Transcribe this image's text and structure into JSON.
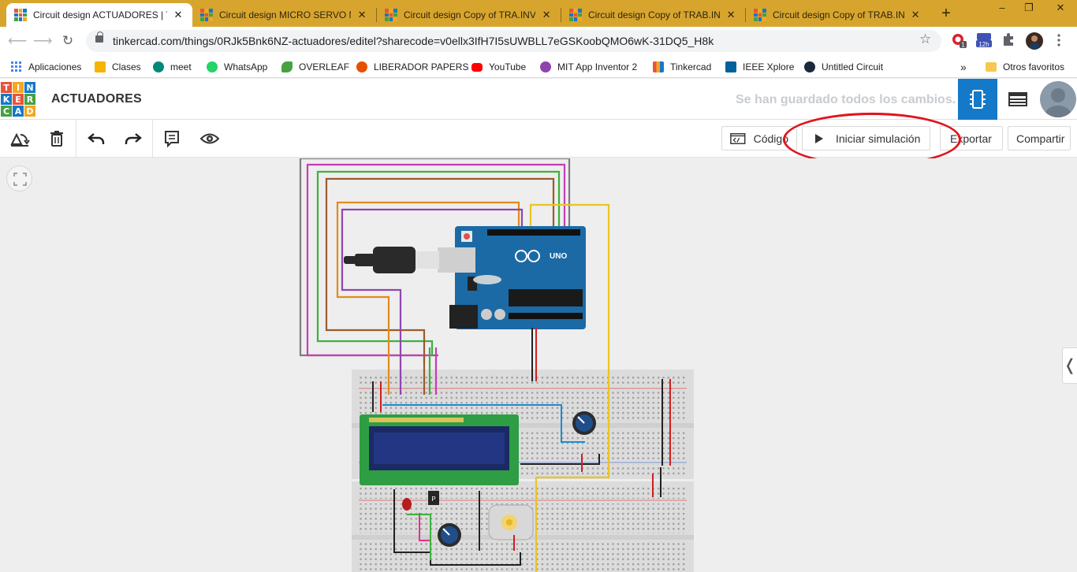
{
  "browser": {
    "tabs": [
      {
        "title": "Circuit design ACTUADORES | Ti",
        "active": true
      },
      {
        "title": "Circuit design MICRO SERVO M"
      },
      {
        "title": "Circuit design Copy of TRA.INV.A"
      },
      {
        "title": "Circuit design Copy of TRAB.INV"
      },
      {
        "title": "Circuit design Copy of TRAB.INV"
      }
    ],
    "new_tab": "+",
    "window_controls": [
      "–",
      "❐",
      "✕"
    ],
    "url": "tinkercad.com/things/0RJk5Bnk6NZ-actuadores/editel?sharecode=v0ellx3IfH7I5sUWBLL7eGSKoobQMO6wK-31DQ5_H8k",
    "extension_badges": [
      "1",
      "12h"
    ]
  },
  "bookmarks": {
    "items": [
      {
        "label": "Aplicaciones",
        "icon": "apps-grid-icon",
        "color": "#4285f4"
      },
      {
        "label": "Clases",
        "icon": "classroom-icon",
        "color": "#f4b400"
      },
      {
        "label": "meet",
        "icon": "meet-icon",
        "color": "#00897b"
      },
      {
        "label": "WhatsApp",
        "icon": "whatsapp-icon",
        "color": "#25d366"
      },
      {
        "label": "OVERLEAF",
        "icon": "overleaf-icon",
        "color": "#47a141"
      },
      {
        "label": "LIBERADOR PAPERS",
        "icon": "liberador-icon",
        "color": "#e65100"
      },
      {
        "label": "YouTube",
        "icon": "youtube-icon",
        "color": "#ff0000"
      },
      {
        "label": "MIT App Inventor 2",
        "icon": "app-inventor-icon",
        "color": "#8e44ad"
      },
      {
        "label": "Tinkercad",
        "icon": "tinkercad-icon",
        "color": "#e8543b"
      },
      {
        "label": "IEEE Xplore",
        "icon": "ieee-icon",
        "color": "#00629b"
      },
      {
        "label": "Untitled Circuit",
        "icon": "circuit-icon",
        "color": "#1a2a3a"
      }
    ],
    "more": "»",
    "others": "Otros favoritos"
  },
  "tinkercad": {
    "logo_letters": [
      "T",
      "I",
      "N",
      "K",
      "E",
      "R",
      "C",
      "A",
      "D"
    ],
    "project_name": "ACTUADORES",
    "save_status": "Se han guardado todos los cambios.",
    "buttons": {
      "code": "Código",
      "simulate": "Iniciar simulación",
      "export": "Exportar",
      "share": "Compartir"
    },
    "side_handle": "❬"
  },
  "colors": {
    "tab_strip": "#d7a52d",
    "accent_blue": "#1479c8",
    "annotation_red": "#e0141c",
    "arduino_blue": "#1b6aa5",
    "lcd_pcb": "#2e9e44",
    "lcd_screen": "#1c2a63"
  }
}
